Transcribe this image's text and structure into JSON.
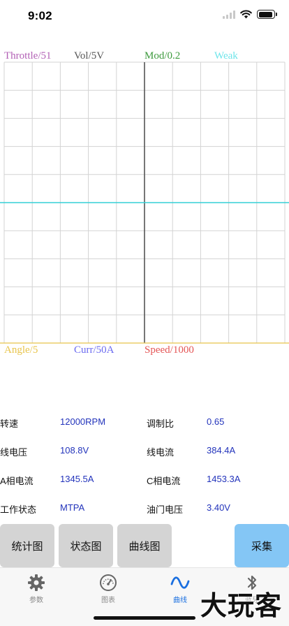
{
  "status_bar": {
    "time": "9:02",
    "battery_level": 0.95
  },
  "chart": {
    "top_labels": [
      {
        "text": "Throttle/51",
        "color": "#b25fb5"
      },
      {
        "text": "Vol/5V",
        "color": "#555555"
      },
      {
        "text": "Mod/0.2",
        "color": "#3d9a3d"
      },
      {
        "text": "Weak",
        "color": "#6fe5ea"
      }
    ],
    "bottom_labels": [
      {
        "text": "Angle/5",
        "color": "#e8c44a"
      },
      {
        "text": "Curr/50A",
        "color": "#6b6bf0"
      },
      {
        "text": "Speed/1000",
        "color": "#e45555"
      }
    ],
    "colors": {
      "grid": "#d3d3d3",
      "center_axis": "#555555",
      "bottom_border": "#e8c44a",
      "trace": "#35d0d6"
    },
    "chart_data": {
      "type": "line",
      "x_divisions": 10,
      "y_divisions": 10,
      "ylim": [
        -1,
        1
      ],
      "series": [
        {
          "name": "Weak",
          "color": "#35d0d6",
          "values": [
            0,
            0
          ]
        }
      ]
    }
  },
  "params": {
    "rows": [
      [
        {
          "label": "转速",
          "value": "12000RPM"
        },
        {
          "label": "调制比",
          "value": "0.65"
        }
      ],
      [
        {
          "label": "线电压",
          "value": "108.8V"
        },
        {
          "label": "线电流",
          "value": "384.4A"
        }
      ],
      [
        {
          "label": "A相电流",
          "value": "1345.5A"
        },
        {
          "label": "C相电流",
          "value": "1453.3A"
        }
      ],
      [
        {
          "label": "工作状态",
          "value": "MTPA"
        },
        {
          "label": "油门电压",
          "value": "3.40V"
        }
      ]
    ]
  },
  "buttons": {
    "stats": "统计图",
    "status": "状态图",
    "curve": "曲线图",
    "collect": "采集"
  },
  "tabs": [
    {
      "label": "参数",
      "icon": "gear-icon"
    },
    {
      "label": "图表",
      "icon": "gauge-icon"
    },
    {
      "label": "曲线",
      "icon": "wave-icon",
      "active": true
    },
    {
      "label": "蓝牙",
      "icon": "bluetooth-icon"
    }
  ],
  "watermark": "大玩客"
}
